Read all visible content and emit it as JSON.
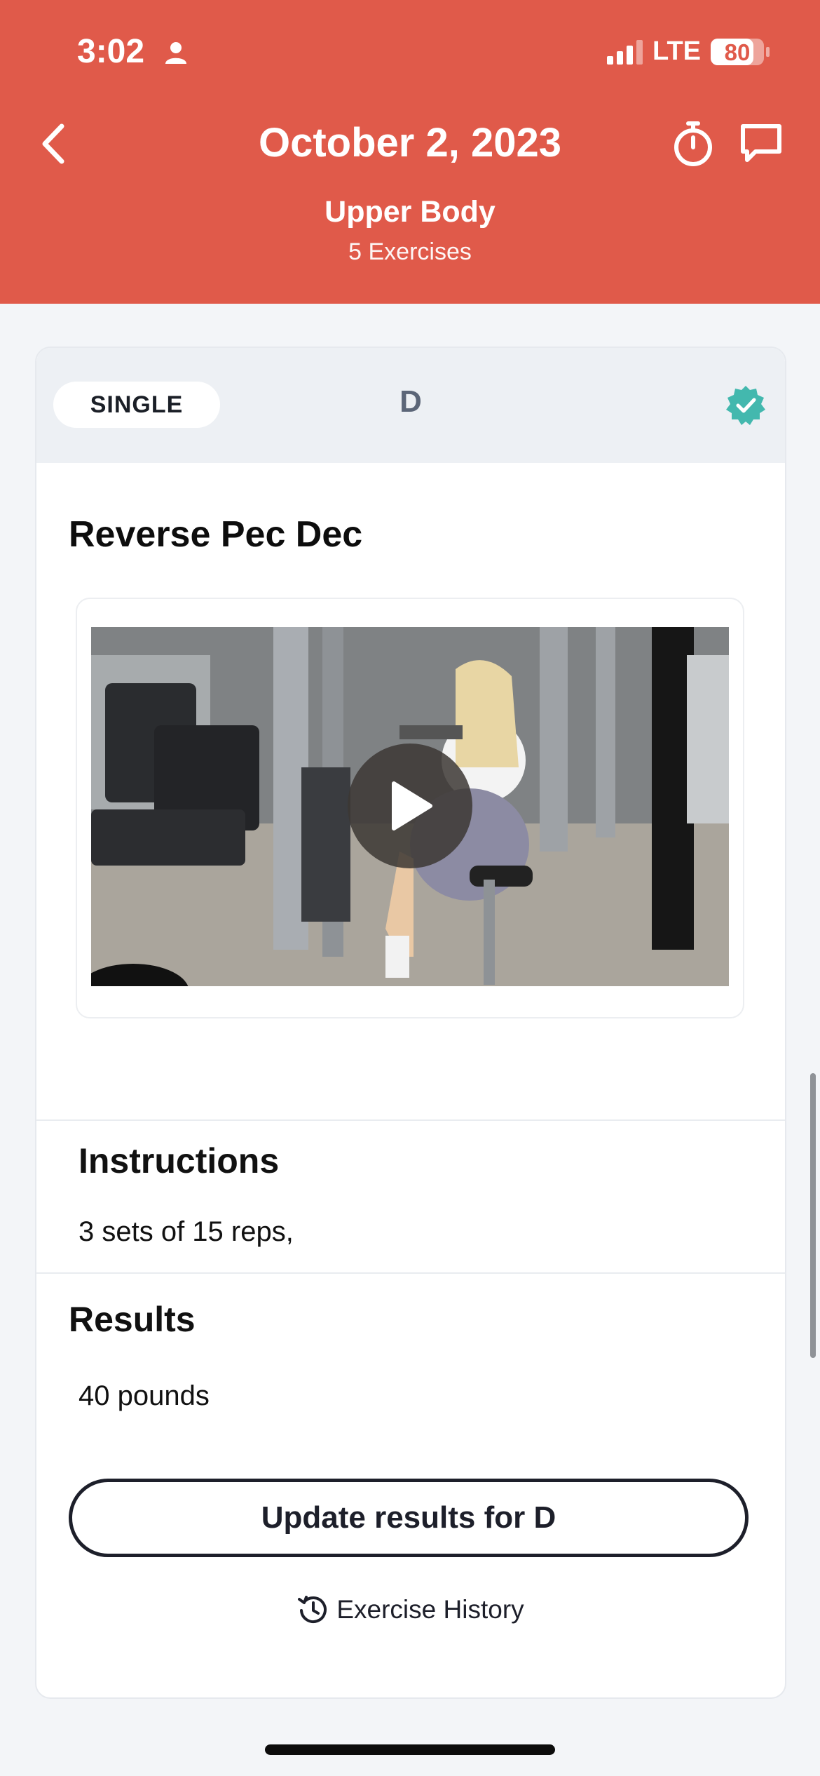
{
  "status_bar": {
    "time": "3:02",
    "network": "LTE",
    "battery_percent": "80",
    "battery_level": 0.8,
    "person_icon": "person-icon",
    "signal_icon": "cellular-signal-icon"
  },
  "header": {
    "date": "October 2, 2023",
    "workout_name": "Upper Body",
    "exercise_count": "5 Exercises",
    "back_icon": "chevron-left-icon",
    "timer_icon": "stopwatch-icon",
    "chat_icon": "chat-bubble-icon",
    "color": "#e05a4a"
  },
  "card": {
    "type_label": "SINGLE",
    "letter": "D",
    "completed_icon": "verified-check-icon",
    "check_color": "#43b8ae",
    "exercise_name": "Reverse Pec Dec",
    "video_play_icon": "play-icon",
    "instructions_heading": "Instructions",
    "instructions_text": "3 sets of 15 reps,",
    "results_heading": "Results",
    "results_text": "40 pounds",
    "update_button_label": "Update results for D",
    "history_icon": "history-clock-icon",
    "history_label": "Exercise History"
  }
}
